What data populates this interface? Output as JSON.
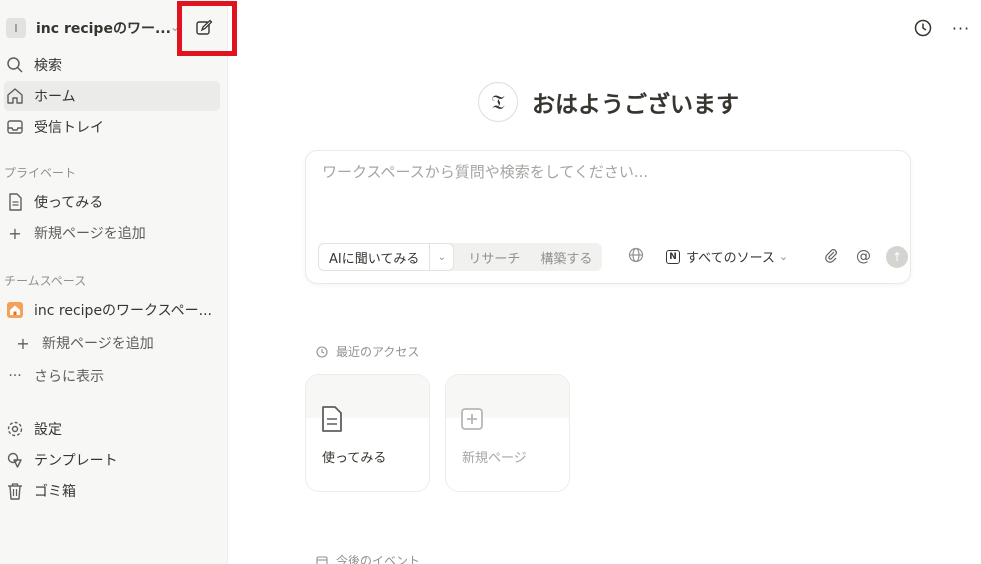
{
  "sidebar": {
    "workspace_badge": "I",
    "workspace_name": "inc recipeのワー...",
    "nav": [
      {
        "label": "検索",
        "icon": "search-icon"
      },
      {
        "label": "ホーム",
        "icon": "home-icon",
        "active": true
      },
      {
        "label": "受信トレイ",
        "icon": "inbox-icon"
      }
    ],
    "private_label": "プライベート",
    "private_items": [
      {
        "label": "使ってみる",
        "icon": "page-icon"
      },
      {
        "label": "新規ページを追加",
        "icon": "plus-icon"
      }
    ],
    "teamspace_label": "チームスペース",
    "teamspace_items": [
      {
        "label": "inc recipeのワークスペー...",
        "icon": "house-emoji-icon"
      },
      {
        "label": "新規ページを追加",
        "icon": "plus-icon"
      },
      {
        "label": "さらに表示",
        "icon": "more-icon"
      }
    ],
    "bottom_items": [
      {
        "label": "設定",
        "icon": "gear-icon"
      },
      {
        "label": "テンプレート",
        "icon": "template-icon"
      },
      {
        "label": "ゴミ箱",
        "icon": "trash-icon"
      }
    ]
  },
  "main": {
    "greeting": "おはようございます",
    "ai": {
      "placeholder": "ワークスペースから質問や検索をしてください...",
      "modes": [
        "AIに聞いてみる",
        "リサーチ",
        "構築する"
      ],
      "sources_label": "すべてのソース"
    },
    "recent_label": "最近のアクセス",
    "recent_cards": [
      {
        "title": "使ってみる",
        "icon": "page-icon"
      },
      {
        "title": "新規ページ",
        "icon": "plus-square-icon"
      }
    ],
    "events_label": "今後のイベント"
  },
  "colors": {
    "highlight": "#e0141e",
    "sidebar_bg": "#f7f7f5",
    "text": "#37352f"
  }
}
